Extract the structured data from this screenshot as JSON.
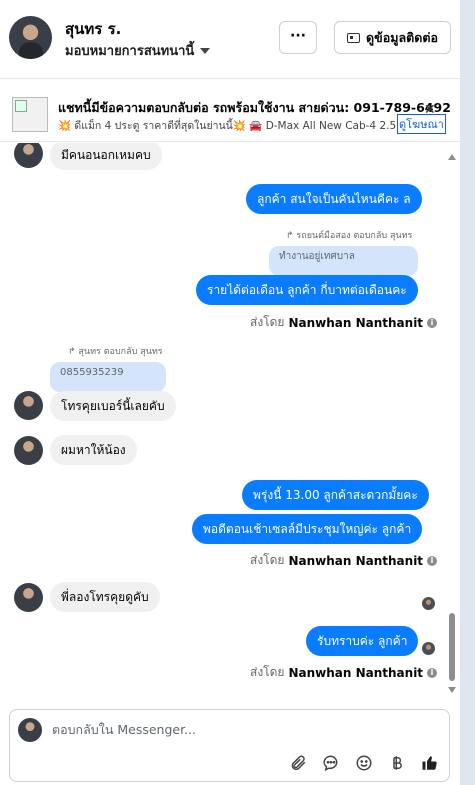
{
  "header": {
    "contact_name": "สุนทร ร.",
    "assignee_label": "มอบหมายการสนทนานี้",
    "more_label": "···",
    "contact_details_label": "ดูข้อมูลติดต่อ"
  },
  "banner": {
    "title": "แชทนี้มีข้อความตอบกลับต่อ รถพร้อมใช้งาน สายด่วน: 091-789-6492",
    "text": "💥 ดีแม็ก 4 ประตู ราคาดีที่สุดในย่านนี้💥  🚘 D-Max All New Cab-4 2.5 S...",
    "link_label": "ดูโฆษณา",
    "close_label": "✕"
  },
  "messages": {
    "m0": "มีคนอนอกเหมคบ",
    "m1": "ลูกค้า สนใจเป็นคันไหนคีคะ ล",
    "m2_reply_label": "รถยนต์มือสอง ตอบกลับ สุนทร",
    "m2_quote": "ทำงานอยู่เทศบาล",
    "m2": "รายได้ต่อเดือน  ลูกค้า กี่บาทต่อเดือนคะ",
    "m3_reply_label": "สุนทร ตอบกลับ สุนทร",
    "m3_quote": "0855935239",
    "m3": "โทรคุยเบอร์นี้เลยคับ",
    "m4": "ผมหาให้น้อง",
    "m5": "พรุ่งนี้ 13.00 ลูกค้าสะดวกมั้ยคะ",
    "m6": "พอดีตอนเช้าเซลล์มีประชุมใหญ่ค่ะ  ลูกค้า",
    "m7": "พี่ลองโทรคุยดูคับ",
    "m8": "รับทราบค่ะ  ลูกค้า",
    "sent_by_prefix": "ส่งโดย",
    "sent_by_name": "Nanwhan Nanthanit",
    "info": "i"
  },
  "composer": {
    "placeholder": "ตอบกลับใน Messenger..."
  },
  "icons": [
    "paperclip-icon",
    "chat-icon",
    "emoji-icon",
    "baht-icon",
    "thumbs-up-icon"
  ],
  "colors": {
    "accent": "#0a7cff",
    "incoming": "#f0f0f0",
    "quote": "#d3e4fb"
  }
}
